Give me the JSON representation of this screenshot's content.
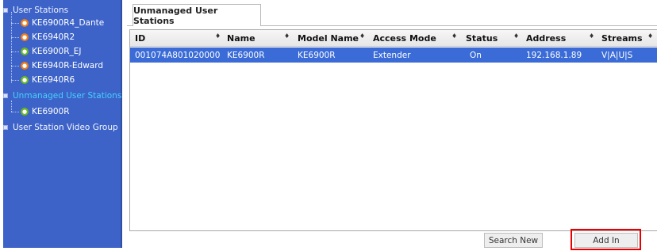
{
  "sidebar": {
    "groups": [
      {
        "label": "User Stations"
      },
      {
        "label": "Unmanaged User Stations"
      },
      {
        "label": "User Station Video Group"
      }
    ],
    "user_stations": [
      {
        "label": "KE6900R4_Dante",
        "status": "orange"
      },
      {
        "label": "KE6940R2",
        "status": "orange"
      },
      {
        "label": "KE6900R_EJ",
        "status": "green"
      },
      {
        "label": "KE6940R-Edward",
        "status": "orange"
      },
      {
        "label": "KE6940R6",
        "status": "green"
      }
    ],
    "unmanaged_stations": [
      {
        "label": "KE6900R",
        "status": "green"
      }
    ]
  },
  "tab": {
    "label": "Unmanaged User Stations"
  },
  "table": {
    "columns": [
      "ID",
      "Name",
      "Model Name",
      "Access Mode",
      "Status",
      "Address",
      "Streams"
    ],
    "sort_icon": "♦",
    "rows": [
      [
        "001074A801020000",
        "KE6900R",
        "KE6900R",
        "Extender",
        "On",
        "192.168.1.89",
        "V|A|U|S"
      ]
    ]
  },
  "buttons": {
    "search_new": "Search New",
    "add_in": "Add In"
  },
  "colors": {
    "sidebar_bg": "#3d63c8",
    "selected_row": "#3a6bd6",
    "status_orange": "#f07d16",
    "status_green": "#6ab820",
    "active_group": "#46d0ff",
    "highlight_box": "#e80000"
  }
}
